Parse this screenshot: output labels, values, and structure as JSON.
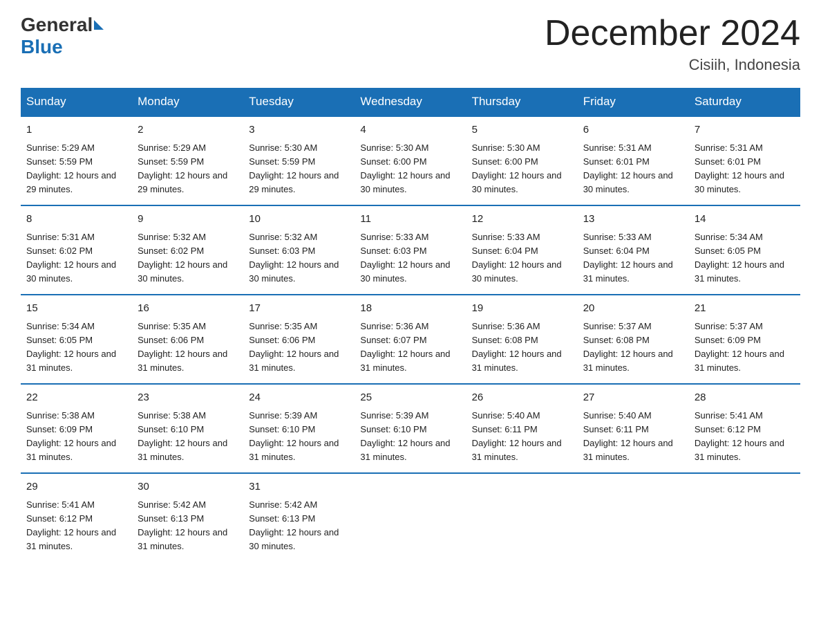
{
  "header": {
    "logo_general": "General",
    "logo_blue": "Blue",
    "title": "December 2024",
    "location": "Cisiih, Indonesia"
  },
  "days_of_week": [
    "Sunday",
    "Monday",
    "Tuesday",
    "Wednesday",
    "Thursday",
    "Friday",
    "Saturday"
  ],
  "weeks": [
    [
      {
        "day": "1",
        "sunrise": "5:29 AM",
        "sunset": "5:59 PM",
        "daylight": "12 hours and 29 minutes."
      },
      {
        "day": "2",
        "sunrise": "5:29 AM",
        "sunset": "5:59 PM",
        "daylight": "12 hours and 29 minutes."
      },
      {
        "day": "3",
        "sunrise": "5:30 AM",
        "sunset": "5:59 PM",
        "daylight": "12 hours and 29 minutes."
      },
      {
        "day": "4",
        "sunrise": "5:30 AM",
        "sunset": "6:00 PM",
        "daylight": "12 hours and 30 minutes."
      },
      {
        "day": "5",
        "sunrise": "5:30 AM",
        "sunset": "6:00 PM",
        "daylight": "12 hours and 30 minutes."
      },
      {
        "day": "6",
        "sunrise": "5:31 AM",
        "sunset": "6:01 PM",
        "daylight": "12 hours and 30 minutes."
      },
      {
        "day": "7",
        "sunrise": "5:31 AM",
        "sunset": "6:01 PM",
        "daylight": "12 hours and 30 minutes."
      }
    ],
    [
      {
        "day": "8",
        "sunrise": "5:31 AM",
        "sunset": "6:02 PM",
        "daylight": "12 hours and 30 minutes."
      },
      {
        "day": "9",
        "sunrise": "5:32 AM",
        "sunset": "6:02 PM",
        "daylight": "12 hours and 30 minutes."
      },
      {
        "day": "10",
        "sunrise": "5:32 AM",
        "sunset": "6:03 PM",
        "daylight": "12 hours and 30 minutes."
      },
      {
        "day": "11",
        "sunrise": "5:33 AM",
        "sunset": "6:03 PM",
        "daylight": "12 hours and 30 minutes."
      },
      {
        "day": "12",
        "sunrise": "5:33 AM",
        "sunset": "6:04 PM",
        "daylight": "12 hours and 30 minutes."
      },
      {
        "day": "13",
        "sunrise": "5:33 AM",
        "sunset": "6:04 PM",
        "daylight": "12 hours and 31 minutes."
      },
      {
        "day": "14",
        "sunrise": "5:34 AM",
        "sunset": "6:05 PM",
        "daylight": "12 hours and 31 minutes."
      }
    ],
    [
      {
        "day": "15",
        "sunrise": "5:34 AM",
        "sunset": "6:05 PM",
        "daylight": "12 hours and 31 minutes."
      },
      {
        "day": "16",
        "sunrise": "5:35 AM",
        "sunset": "6:06 PM",
        "daylight": "12 hours and 31 minutes."
      },
      {
        "day": "17",
        "sunrise": "5:35 AM",
        "sunset": "6:06 PM",
        "daylight": "12 hours and 31 minutes."
      },
      {
        "day": "18",
        "sunrise": "5:36 AM",
        "sunset": "6:07 PM",
        "daylight": "12 hours and 31 minutes."
      },
      {
        "day": "19",
        "sunrise": "5:36 AM",
        "sunset": "6:08 PM",
        "daylight": "12 hours and 31 minutes."
      },
      {
        "day": "20",
        "sunrise": "5:37 AM",
        "sunset": "6:08 PM",
        "daylight": "12 hours and 31 minutes."
      },
      {
        "day": "21",
        "sunrise": "5:37 AM",
        "sunset": "6:09 PM",
        "daylight": "12 hours and 31 minutes."
      }
    ],
    [
      {
        "day": "22",
        "sunrise": "5:38 AM",
        "sunset": "6:09 PM",
        "daylight": "12 hours and 31 minutes."
      },
      {
        "day": "23",
        "sunrise": "5:38 AM",
        "sunset": "6:10 PM",
        "daylight": "12 hours and 31 minutes."
      },
      {
        "day": "24",
        "sunrise": "5:39 AM",
        "sunset": "6:10 PM",
        "daylight": "12 hours and 31 minutes."
      },
      {
        "day": "25",
        "sunrise": "5:39 AM",
        "sunset": "6:10 PM",
        "daylight": "12 hours and 31 minutes."
      },
      {
        "day": "26",
        "sunrise": "5:40 AM",
        "sunset": "6:11 PM",
        "daylight": "12 hours and 31 minutes."
      },
      {
        "day": "27",
        "sunrise": "5:40 AM",
        "sunset": "6:11 PM",
        "daylight": "12 hours and 31 minutes."
      },
      {
        "day": "28",
        "sunrise": "5:41 AM",
        "sunset": "6:12 PM",
        "daylight": "12 hours and 31 minutes."
      }
    ],
    [
      {
        "day": "29",
        "sunrise": "5:41 AM",
        "sunset": "6:12 PM",
        "daylight": "12 hours and 31 minutes."
      },
      {
        "day": "30",
        "sunrise": "5:42 AM",
        "sunset": "6:13 PM",
        "daylight": "12 hours and 31 minutes."
      },
      {
        "day": "31",
        "sunrise": "5:42 AM",
        "sunset": "6:13 PM",
        "daylight": "12 hours and 30 minutes."
      },
      null,
      null,
      null,
      null
    ]
  ]
}
